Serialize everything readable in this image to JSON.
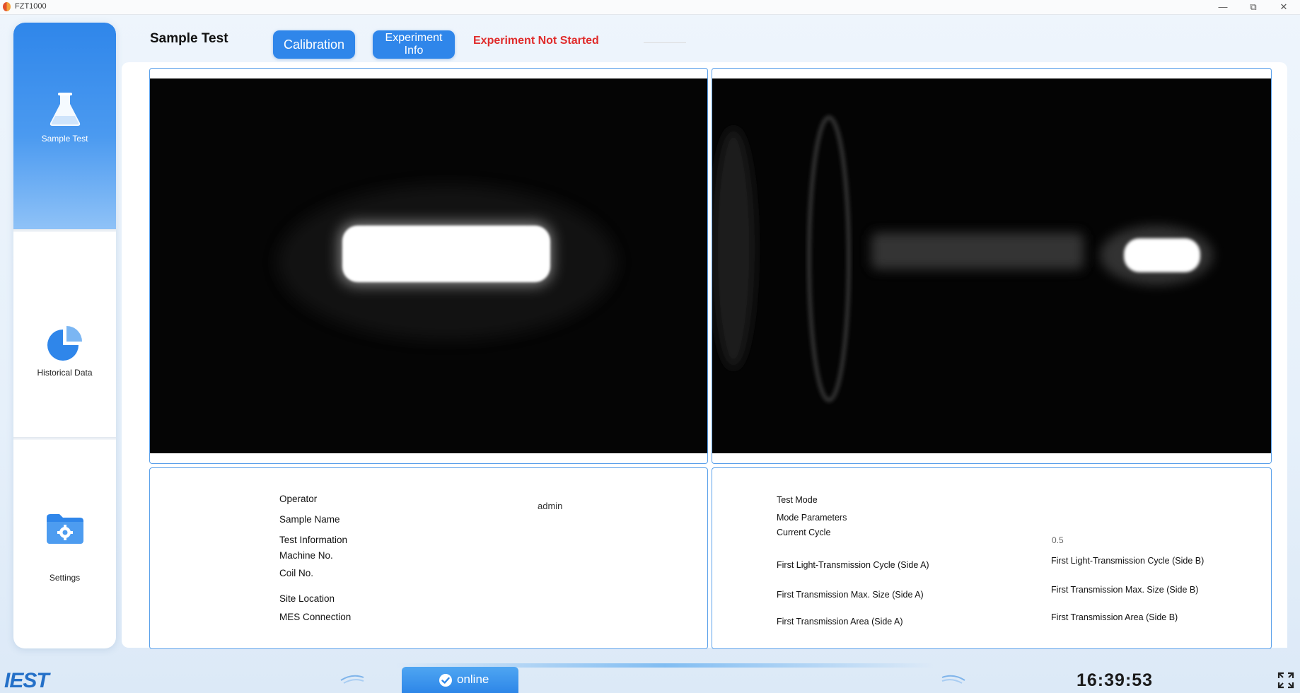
{
  "app": {
    "title": "FZT1000"
  },
  "window_controls": {
    "minimize": "—",
    "restore": "⧉",
    "close": "✕"
  },
  "sidebar": {
    "items": [
      {
        "label": "Sample Test",
        "icon": "flask-icon",
        "active": true
      },
      {
        "label": "Historical Data",
        "icon": "pie-chart-icon",
        "active": false
      },
      {
        "label": "Settings",
        "icon": "gear-folder-icon",
        "active": false
      }
    ]
  },
  "header": {
    "title": "Sample Test",
    "calibration_label": "Calibration",
    "experiment_info_line1": "Experiment",
    "experiment_info_line2": "Info",
    "status": "Experiment Not Started"
  },
  "info_left": {
    "operator_label": "Operator",
    "operator_value": "admin",
    "sample_name_label": "Sample Name",
    "test_info_label": "Test Information",
    "machine_no_label": "Machine No.",
    "coil_no_label": "Coil No.",
    "site_location_label": "Site Location",
    "mes_connection_label": "MES Connection"
  },
  "info_right": {
    "test_mode_label": "Test Mode",
    "mode_params_label": "Mode Parameters",
    "current_cycle_label": "Current Cycle",
    "current_cycle_value": "0.5",
    "first_cycle_a_label": "First Light-Transmission Cycle (Side A)",
    "first_cycle_b_label": "First Light-Transmission Cycle (Side B)",
    "first_max_a_label": "First Transmission Max. Size (Side A)",
    "first_max_b_label": "First Transmission Max. Size (Side B)",
    "first_area_a_label": "First Transmission Area (Side A)",
    "first_area_b_label": "First Transmission Area (Side B)"
  },
  "footer": {
    "brand": "IEST",
    "online_label": "online",
    "clock": "16:39:53"
  },
  "colors": {
    "accent": "#2f86ea",
    "status_red": "#e02b2b",
    "frame_border": "#5aa0ea"
  }
}
